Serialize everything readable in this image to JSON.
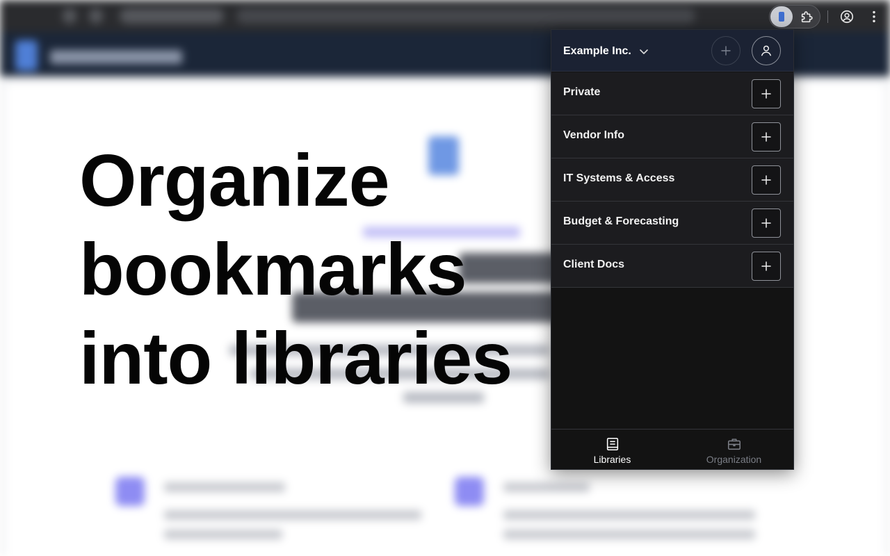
{
  "hero": {
    "lines": [
      "Organize",
      "bookmarks",
      "into libraries"
    ]
  },
  "browser_toolbar": {
    "icons": [
      "bookmark-extension-icon",
      "puzzle-icon",
      "profile-icon",
      "kebab-menu-icon"
    ]
  },
  "popup": {
    "org_name": "Example Inc.",
    "libraries": [
      {
        "label": "Private"
      },
      {
        "label": "Vendor Info"
      },
      {
        "label": "IT Systems & Access"
      },
      {
        "label": "Budget & Forecasting"
      },
      {
        "label": "Client Docs"
      }
    ],
    "nav": {
      "libraries_label": "Libraries",
      "organization_label": "Organization",
      "active": "Libraries"
    }
  },
  "colors": {
    "popup_bg": "#131313",
    "header_bg": "#1b2233",
    "row_bg": "#1c1c1f",
    "accent_blue": "#3f6fd0",
    "hero_text": "#050505"
  }
}
